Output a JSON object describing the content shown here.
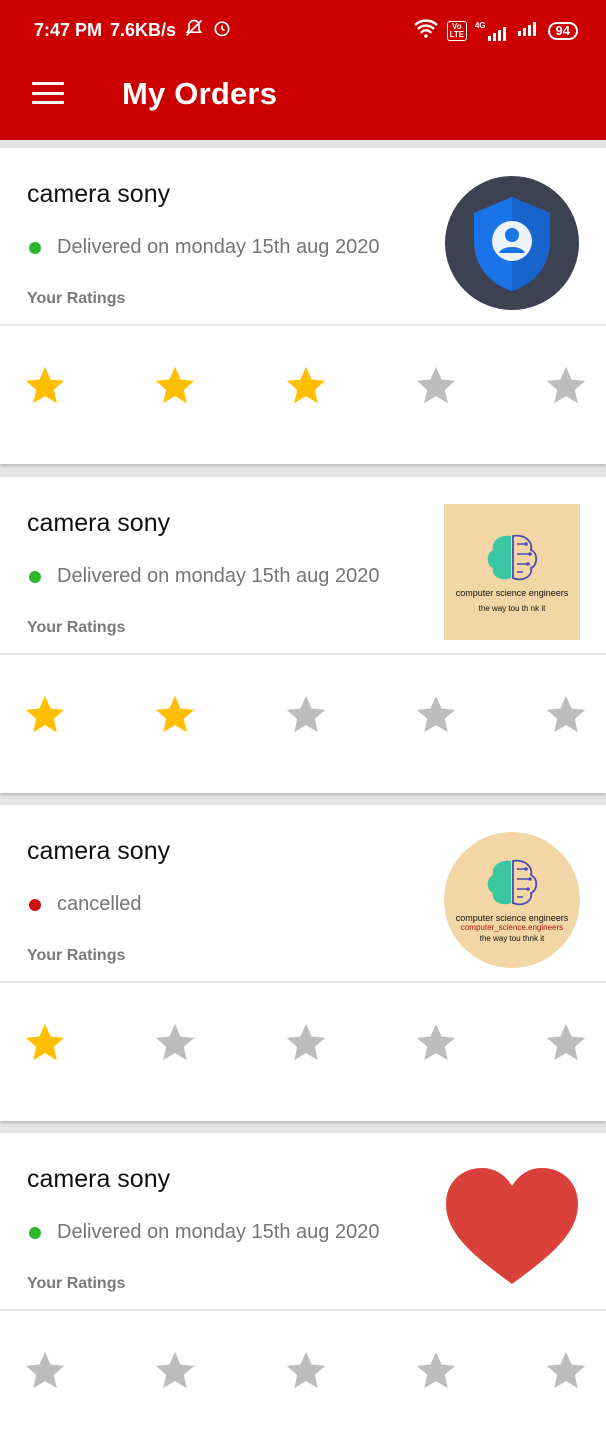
{
  "status_bar": {
    "time": "7:47 PM",
    "speed": "7.6KB/s",
    "volte_label": "Vo LTE",
    "network": "4G",
    "battery": "94"
  },
  "header": {
    "title": "My Orders"
  },
  "colors": {
    "appbar": "#cc0000",
    "star_filled": "#ffbf00",
    "star_empty": "#bdbdbd",
    "delivered": "#2db52d",
    "cancelled": "#cc1111"
  },
  "orders": [
    {
      "product": "camera sony",
      "status": "Delivered on monday 15th aug 2020",
      "status_type": "delivered",
      "ratings_label": "Your Ratings",
      "rating": 3,
      "image_icon": "shield-user-icon"
    },
    {
      "product": "camera sony",
      "status": "Delivered on monday 15th aug 2020",
      "status_type": "delivered",
      "ratings_label": "Your Ratings",
      "rating": 2,
      "image_icon": "brain-logo",
      "image_caption": "computer science engineers",
      "image_tagline": "the way tou th nk it"
    },
    {
      "product": "camera sony",
      "status": "cancelled",
      "status_type": "cancelled",
      "ratings_label": "Your Ratings",
      "rating": 1,
      "image_icon": "brain-logo",
      "image_caption": "computer science engineers",
      "image_subcaption": "computer_science.engineers",
      "image_tagline": "the way tou thnk it"
    },
    {
      "product": "camera sony",
      "status": "Delivered on monday 15th aug 2020",
      "status_type": "delivered",
      "ratings_label": "Your Ratings",
      "rating": 0,
      "image_icon": "heart-icon"
    }
  ]
}
